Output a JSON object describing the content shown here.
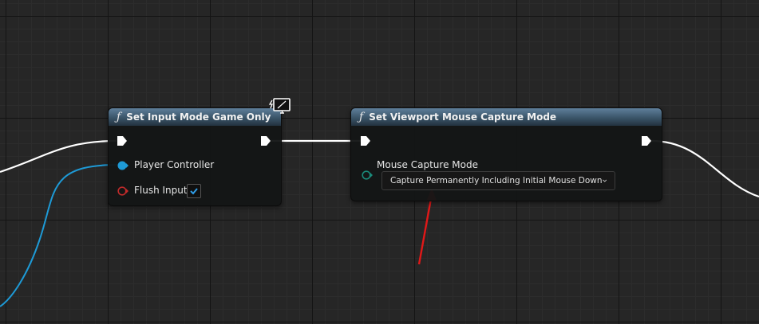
{
  "nodes": {
    "set_input_mode": {
      "title": "Set Input Mode Game Only",
      "function_icon": "ƒ",
      "inputs": [
        {
          "label": "Player Controller",
          "pin_color": "#1e9ad6"
        },
        {
          "label": "Flush Input",
          "pin_color": "#c22b2b",
          "checked": true
        }
      ],
      "badge_icon": "monitor-icon"
    },
    "set_viewport_capture": {
      "title": "Set Viewport Mouse Capture Mode",
      "function_icon": "ƒ",
      "input_label": "Mouse Capture Mode",
      "pin_color": "#1a8a7a",
      "dropdown_value": "Capture Permanently Including Initial Mouse Down"
    }
  },
  "colors": {
    "exec_wire": "#ffffff",
    "object_wire": "#1e9ad6",
    "annotation_arrow": "#e01818",
    "header": "#3a5468"
  }
}
